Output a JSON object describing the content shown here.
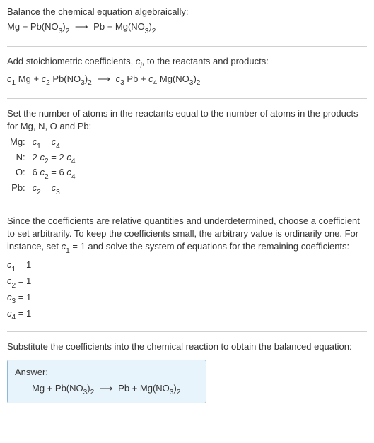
{
  "section1": {
    "title": "Balance the chemical equation algebraically:",
    "lhs1": "Mg",
    "plus": "+",
    "lhs2a": "Pb(NO",
    "lhs2b": "3",
    "lhs2c": ")",
    "lhs2d": "2",
    "arrow": "⟶",
    "rhs1": "Pb",
    "rhs2a": "Mg(NO",
    "rhs2b": "3",
    "rhs2c": ")",
    "rhs2d": "2"
  },
  "section2": {
    "line1a": "Add stoichiometric coefficients, ",
    "line1b": "c",
    "line1c": "i",
    "line1d": ", to the reactants and products:",
    "c1": "c",
    "c1s": "1",
    "sp1": " Mg",
    "plus": "+",
    "c2": "c",
    "c2s": "2",
    "sp2a": " Pb(NO",
    "sp2b": "3",
    "sp2c": ")",
    "sp2d": "2",
    "arrow": "⟶",
    "c3": "c",
    "c3s": "3",
    "sp3": " Pb",
    "c4": "c",
    "c4s": "4",
    "sp4a": " Mg(NO",
    "sp4b": "3",
    "sp4c": ")",
    "sp4d": "2"
  },
  "section3": {
    "intro": "Set the number of atoms in the reactants equal to the number of atoms in the products for Mg, N, O and Pb:",
    "rows": {
      "r1": {
        "label": "Mg:",
        "la": "c",
        "ls": "1",
        "eq": " = ",
        "ra": "c",
        "rs": "4",
        "lp": "",
        "rp": ""
      },
      "r2": {
        "label": "N:",
        "la": "c",
        "ls": "2",
        "eq": " = 2 ",
        "ra": "c",
        "rs": "4",
        "lp": "2 ",
        "rp": ""
      },
      "r3": {
        "label": "O:",
        "la": "c",
        "ls": "2",
        "eq": " = 6 ",
        "ra": "c",
        "rs": "4",
        "lp": "6 ",
        "rp": ""
      },
      "r4": {
        "label": "Pb:",
        "la": "c",
        "ls": "2",
        "eq": " = ",
        "ra": "c",
        "rs": "3",
        "lp": "",
        "rp": ""
      }
    }
  },
  "section4": {
    "intro": "Since the coefficients are relative quantities and underdetermined, choose a coefficient to set arbitrarily. To keep the coefficients small, the arbitrary value is ordinarily one. For instance, set ",
    "ca": "c",
    "cs": "1",
    "intro2": " = 1 and solve the system of equations for the remaining coefficients:",
    "sols": {
      "s1": {
        "c": "c",
        "s": "1",
        "v": " = 1"
      },
      "s2": {
        "c": "c",
        "s": "2",
        "v": " = 1"
      },
      "s3": {
        "c": "c",
        "s": "3",
        "v": " = 1"
      },
      "s4": {
        "c": "c",
        "s": "4",
        "v": " = 1"
      }
    }
  },
  "section5": {
    "intro": "Substitute the coefficients into the chemical reaction to obtain the balanced equation:",
    "answer_label": "Answer:",
    "lhs1": "Mg",
    "plus": "+",
    "lhs2a": "Pb(NO",
    "lhs2b": "3",
    "lhs2c": ")",
    "lhs2d": "2",
    "arrow": "⟶",
    "rhs1": "Pb",
    "rhs2a": "Mg(NO",
    "rhs2b": "3",
    "rhs2c": ")",
    "rhs2d": "2"
  }
}
